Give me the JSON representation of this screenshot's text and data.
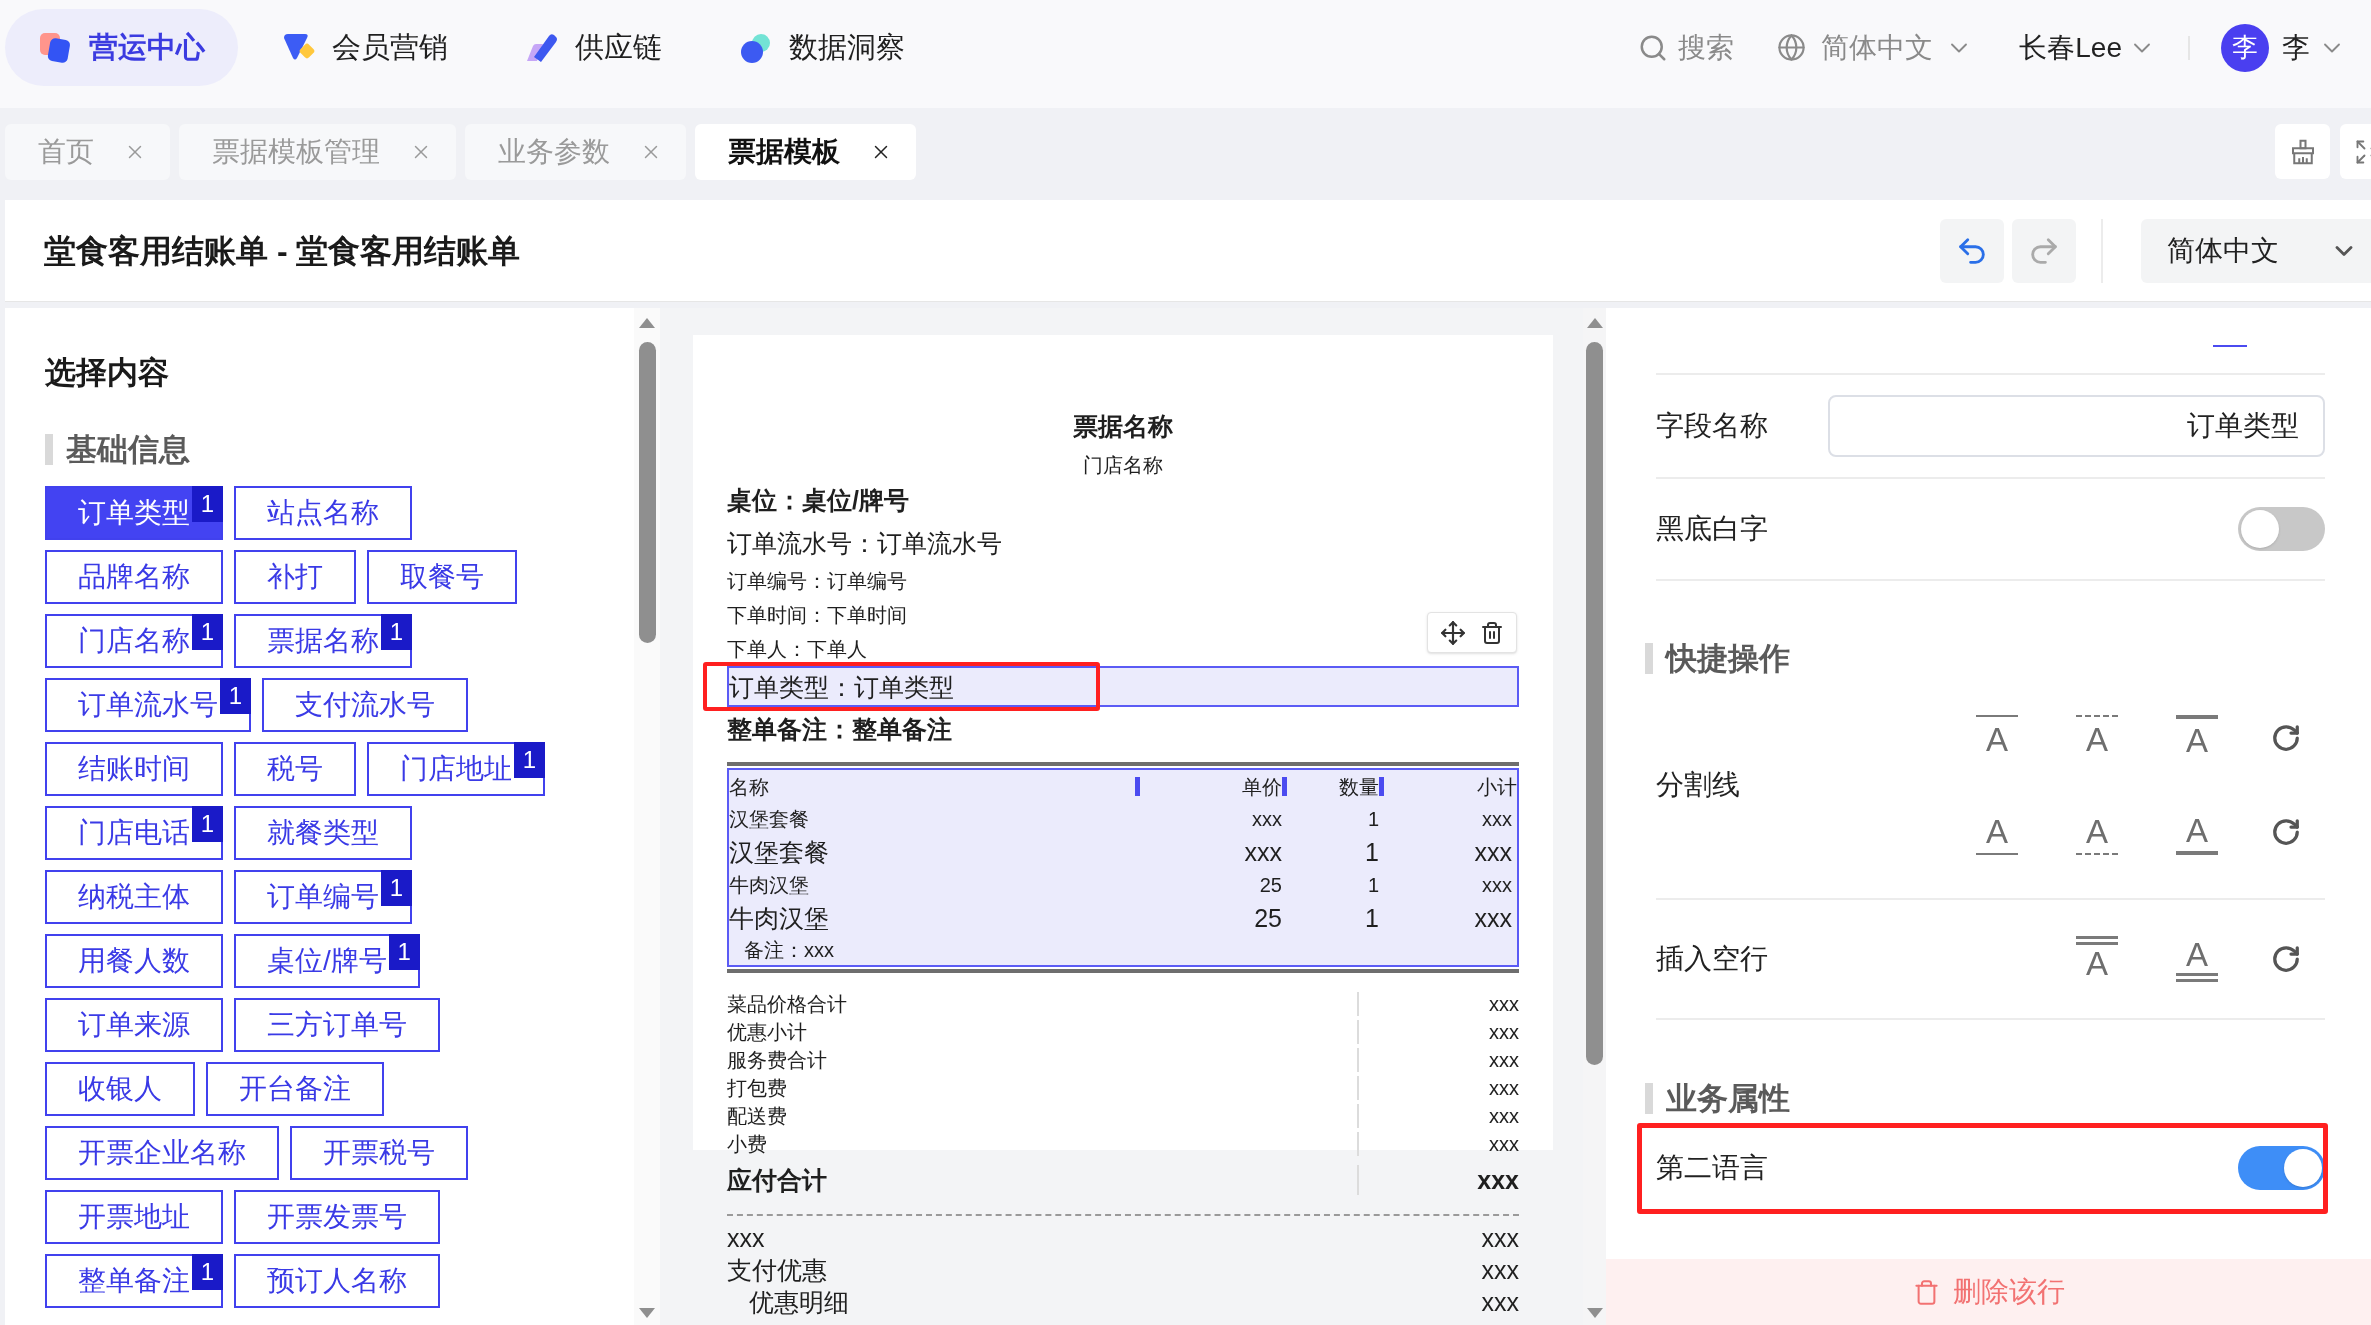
{
  "top_nav": {
    "menu": [
      {
        "label": "营运中心",
        "selected": true
      },
      {
        "label": "会员营销",
        "selected": false
      },
      {
        "label": "供应链",
        "selected": false
      },
      {
        "label": "数据洞察",
        "selected": false
      }
    ],
    "search": "搜索",
    "language": "简体中文",
    "store": "长春Lee",
    "user": {
      "avatar": "李",
      "name": "李"
    }
  },
  "tabs": [
    {
      "label": "首页",
      "selected": false
    },
    {
      "label": "票据模板管理",
      "selected": false
    },
    {
      "label": "业务参数",
      "selected": false
    },
    {
      "label": "票据模板",
      "selected": true
    }
  ],
  "header": {
    "title": "堂食客用结账单 - 堂食客用结账单",
    "history": [
      {
        "kind": "undo",
        "disabled": false
      },
      {
        "kind": "redo",
        "disabled": true
      }
    ],
    "language": "简体中文"
  },
  "content_panel": {
    "title": "选择内容",
    "section": "基础信息",
    "tags": [
      {
        "label": "订单类型",
        "badge": "1",
        "selected": true
      },
      {
        "label": "站点名称",
        "selected": false
      },
      {
        "label": "品牌名称",
        "selected": false
      },
      {
        "label": "补打",
        "selected": false
      },
      {
        "label": "取餐号",
        "selected": false
      },
      {
        "label": "门店名称",
        "badge": "1",
        "selected": false
      },
      {
        "label": "票据名称",
        "badge": "1",
        "selected": false
      },
      {
        "label": "订单流水号",
        "badge": "1",
        "selected": false
      },
      {
        "label": "支付流水号",
        "selected": false
      },
      {
        "label": "结账时间",
        "selected": false
      },
      {
        "label": "税号",
        "selected": false
      },
      {
        "label": "门店地址",
        "badge": "1",
        "selected": false
      },
      {
        "label": "门店电话",
        "badge": "1",
        "selected": false
      },
      {
        "label": "就餐类型",
        "selected": false
      },
      {
        "label": "纳税主体",
        "selected": false
      },
      {
        "label": "订单编号",
        "badge": "1",
        "selected": false
      },
      {
        "label": "用餐人数",
        "selected": false
      },
      {
        "label": "桌位/牌号",
        "badge": "1",
        "selected": false
      },
      {
        "label": "订单来源",
        "selected": false
      },
      {
        "label": "三方订单号",
        "selected": false
      },
      {
        "label": "收银人",
        "selected": false
      },
      {
        "label": "开台备注",
        "selected": false
      },
      {
        "label": "开票企业名称",
        "selected": false
      },
      {
        "label": "开票税号",
        "selected": false
      },
      {
        "label": "开票地址",
        "selected": false
      },
      {
        "label": "开票发票号",
        "selected": false
      },
      {
        "label": "整单备注",
        "badge": "1",
        "selected": false
      },
      {
        "label": "预订人名称",
        "selected": false
      }
    ]
  },
  "receipt": {
    "lines": [
      {
        "kind": "title",
        "text": "票据名称",
        "selected": false,
        "highlighted": false
      },
      {
        "kind": "subtitle",
        "text": "门店名称",
        "selected": false,
        "highlighted": false
      },
      {
        "kind": "large-bold",
        "text": "桌位：桌位/牌号",
        "selected": false,
        "highlighted": false
      },
      {
        "kind": "large",
        "text": "订单流水号：订单流水号",
        "selected": false,
        "highlighted": false
      },
      {
        "kind": "small",
        "text": "订单编号：订单编号",
        "selected": false,
        "highlighted": false
      },
      {
        "kind": "small",
        "text": "下单时间：下单时间",
        "selected": false,
        "highlighted": false
      },
      {
        "kind": "small",
        "text": "下单人：下单人",
        "selected": false,
        "highlighted": false
      },
      {
        "kind": "large",
        "text": "订单类型：订单类型",
        "selected": true,
        "highlighted": true
      },
      {
        "kind": "large-bold",
        "text": "整单备注：整单备注",
        "selected": false,
        "highlighted": false
      }
    ],
    "items": {
      "selected": true,
      "columns": [
        "名称",
        "单价",
        "数量",
        "小计"
      ],
      "rows": [
        {
          "kind": "small",
          "cells": [
            "汉堡套餐",
            "xxx",
            "1",
            "xxx"
          ]
        },
        {
          "kind": "large",
          "cells": [
            "汉堡套餐",
            "xxx",
            "1",
            "xxx"
          ]
        },
        {
          "kind": "small",
          "cells": [
            "牛肉汉堡",
            "25",
            "1",
            "xxx"
          ]
        },
        {
          "kind": "large",
          "cells": [
            "牛肉汉堡",
            "25",
            "1",
            "xxx"
          ]
        }
      ],
      "note": "备注：xxx"
    },
    "summary": [
      {
        "label": "菜品价格合计",
        "value": "xxx"
      },
      {
        "label": "优惠小计",
        "value": "xxx"
      },
      {
        "label": "服务费合计",
        "value": "xxx"
      },
      {
        "label": "打包费",
        "value": "xxx"
      },
      {
        "label": "配送费",
        "value": "xxx"
      },
      {
        "label": "小费",
        "value": "xxx"
      }
    ],
    "total": {
      "label": "应付合计",
      "value": "xxx"
    },
    "payments": [
      {
        "kind": "plain",
        "label": "xxx",
        "value": "xxx"
      },
      {
        "kind": "plain",
        "label": "支付优惠",
        "value": "xxx"
      },
      {
        "kind": "indented",
        "label": "优惠明细",
        "value": "xxx"
      }
    ]
  },
  "properties": {
    "field_name": {
      "label": "字段名称",
      "value": "订单类型"
    },
    "inverse_text": {
      "label": "黑底白字",
      "on": false
    },
    "quick_actions": {
      "title": "快捷操作",
      "rows": [
        {
          "kind": "divider",
          "label": "分割线",
          "button_rows": [
            [
              {
                "kind": "top-thin",
                "glyph": "A"
              },
              {
                "kind": "top-dashed",
                "glyph": "A"
              },
              {
                "kind": "top-thick",
                "glyph": "A"
              },
              {
                "kind": "reset"
              }
            ],
            [
              {
                "kind": "bottom-thin",
                "glyph": "A"
              },
              {
                "kind": "bottom-dashed",
                "glyph": "A"
              },
              {
                "kind": "bottom-thick",
                "glyph": "A"
              },
              {
                "kind": "reset"
              }
            ]
          ]
        },
        {
          "kind": "blank-line",
          "label": "插入空行",
          "button_rows": [
            [
              {
                "kind": "blank-above",
                "glyph": "A"
              },
              {
                "kind": "blank-below",
                "glyph": "A"
              },
              {
                "kind": "reset"
              }
            ]
          ]
        }
      ]
    },
    "business": {
      "title": "业务属性",
      "toggles": [
        {
          "label": "第二语言",
          "on": true,
          "highlighted": true
        }
      ]
    },
    "delete_button": "删除该行"
  }
}
